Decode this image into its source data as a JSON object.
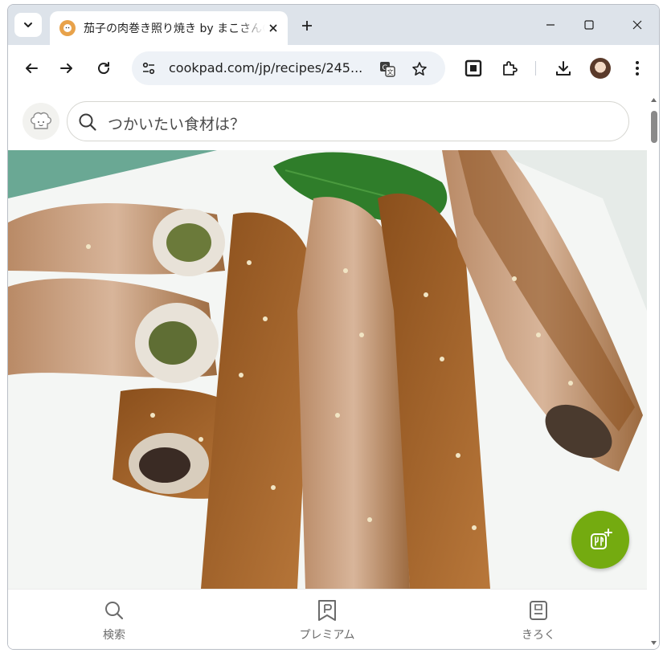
{
  "browser": {
    "tab": {
      "title": "茄子の肉巻き照り焼き by まこさん😊",
      "favicon": "cookpad-favicon"
    },
    "new_tab_icon": "plus-icon",
    "window_controls": [
      "minimize-icon",
      "maximize-icon",
      "close-icon"
    ],
    "nav": [
      "back-arrow-icon",
      "forward-arrow-icon",
      "reload-icon"
    ],
    "omnibox": {
      "url": "cookpad.com/jp/recipes/245...",
      "icons": [
        "site-info-icon",
        "translate-icon",
        "star-icon"
      ]
    },
    "toolbar_icons": [
      "qr-code-icon",
      "extensions-icon",
      "download-icon",
      "profile-avatar",
      "more-menu-icon"
    ]
  },
  "page": {
    "search": {
      "placeholder": "つかいたい食材は？"
    },
    "photo_alt": "茄子の肉巻き照り焼き",
    "fab_icon": "add-recipe-icon",
    "bottom_nav": [
      {
        "label": "検索",
        "icon": "search-icon"
      },
      {
        "label": "プレミアム",
        "icon": "premium-icon"
      },
      {
        "label": "きろく",
        "icon": "record-icon"
      }
    ]
  },
  "colors": {
    "accent": "#74ab10",
    "tabstrip": "#dde3ea",
    "omnibox": "#eef2f7"
  }
}
